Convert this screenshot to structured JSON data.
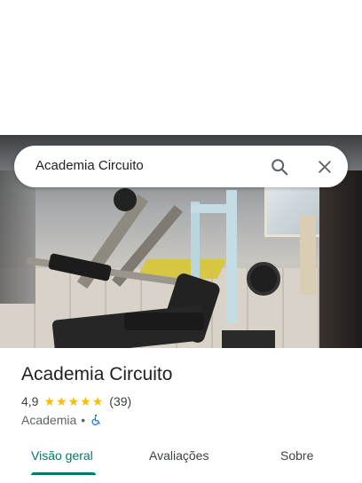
{
  "search": {
    "query": "Academia Circuito"
  },
  "place": {
    "name": "Academia Circuito",
    "rating": "4,9",
    "stars": 5,
    "review_count": "(39)",
    "category": "Academia",
    "separator": "•"
  },
  "tabs": [
    {
      "label": "Visão geral",
      "active": true
    },
    {
      "label": "Avaliações",
      "active": false
    },
    {
      "label": "Sobre",
      "active": false
    }
  ],
  "colors": {
    "accent": "#00796b",
    "star": "#fbbc04",
    "accessible_icon": "#1a73e8"
  },
  "icons": {
    "search": "search-icon",
    "close": "close-icon",
    "accessibility": "wheelchair-icon"
  }
}
